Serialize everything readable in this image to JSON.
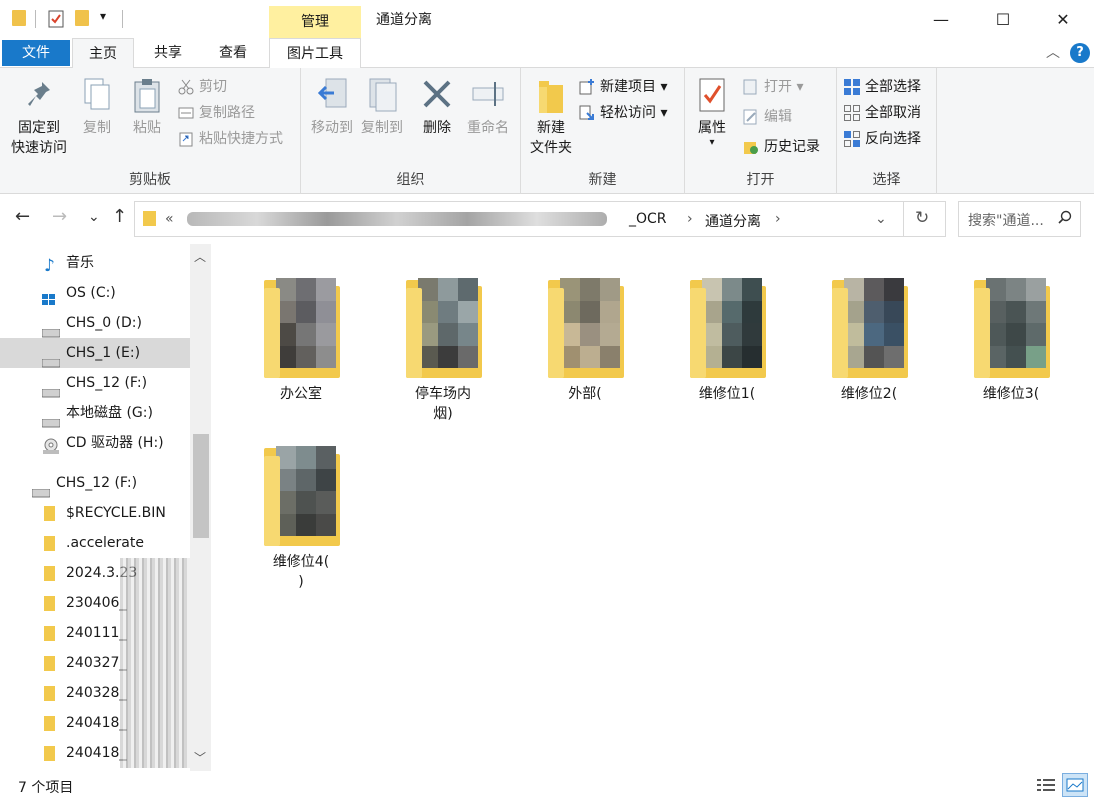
{
  "window": {
    "title": "通道分离",
    "context_tab": "管理",
    "min_glyph": "—",
    "max_glyph": "☐",
    "close_glyph": "✕",
    "quick_access_arrow": "▾"
  },
  "tabs": [
    {
      "label": "文件"
    },
    {
      "label": "主页"
    },
    {
      "label": "共享"
    },
    {
      "label": "查看"
    },
    {
      "label": "图片工具"
    }
  ],
  "ribbon": {
    "collapse_glyph": "︿",
    "help_glyph": "?",
    "clipboard": {
      "label": "剪贴板",
      "pin_line1": "固定到",
      "pin_line2": "快速访问",
      "copy": "复制",
      "paste": "粘贴",
      "cut": "剪切",
      "copy_path": "复制路径",
      "paste_shortcut": "粘贴快捷方式"
    },
    "organize": {
      "label": "组织",
      "move_to": "移动到",
      "copy_to": "复制到",
      "delete": "删除",
      "rename": "重命名"
    },
    "new": {
      "label": "新建",
      "new_folder_line1": "新建",
      "new_folder_line2": "文件夹",
      "new_item": "新建项目",
      "easy_access": "轻松访问"
    },
    "open": {
      "label": "打开",
      "properties": "属性",
      "open": "打开",
      "edit": "编辑",
      "history": "历史记录"
    },
    "select": {
      "label": "选择",
      "select_all": "全部选择",
      "select_none": "全部取消",
      "invert": "反向选择"
    }
  },
  "nav": {
    "back": "←",
    "forward": "→",
    "recent": "⌄",
    "up": "↑",
    "address_prefix": "«",
    "crumb_partial": "_OCR",
    "crumb_current": "通道分离",
    "crumb_sep": "›",
    "dropdown": "⌄",
    "refresh": "↻",
    "search_placeholder": "搜索\"通道..."
  },
  "sidebar": {
    "items": [
      {
        "label": "音乐",
        "icon": "music-icon"
      },
      {
        "label": "OS (C:)",
        "icon": "windows-drive-icon"
      },
      {
        "label": "CHS_0 (D:)",
        "icon": "drive-icon"
      },
      {
        "label": "CHS_1 (E:)",
        "icon": "drive-icon",
        "selected": true
      },
      {
        "label": "CHS_12 (F:)",
        "icon": "drive-icon"
      },
      {
        "label": "本地磁盘 (G:)",
        "icon": "drive-icon"
      },
      {
        "label": "CD 驱动器 (H:)",
        "icon": "cd-drive-icon"
      },
      {
        "label": "CHS_12 (F:)",
        "icon": "drive-icon"
      },
      {
        "label": "$RECYCLE.BIN",
        "icon": "folder-icon"
      },
      {
        "label": ".accelerate",
        "icon": "folder-icon"
      },
      {
        "label": "2024.3.23",
        "icon": "folder-icon"
      },
      {
        "label": "230406_",
        "icon": "folder-icon"
      },
      {
        "label": "240111_",
        "icon": "folder-icon"
      },
      {
        "label": "240327_",
        "icon": "folder-icon"
      },
      {
        "label": "240328_",
        "icon": "folder-icon"
      },
      {
        "label": "240418_",
        "icon": "folder-icon"
      },
      {
        "label": "240418_",
        "icon": "folder-icon"
      }
    ],
    "scroll_up": "︿",
    "scroll_down": "﹀"
  },
  "files": [
    {
      "name": "办公室"
    },
    {
      "name": "停车场内",
      "name2": "烟)"
    },
    {
      "name": "外部("
    },
    {
      "name": "维修位1("
    },
    {
      "name": "维修位2("
    },
    {
      "name": "维修位3("
    },
    {
      "name": "维修位4(",
      "name2": ")"
    }
  ],
  "status": {
    "count": "7 个项目"
  },
  "colors": {
    "accent": "#1979ca",
    "folder": "#f2c94c",
    "context_tab": "#fff0a0",
    "selected": "#d9d9d9"
  }
}
